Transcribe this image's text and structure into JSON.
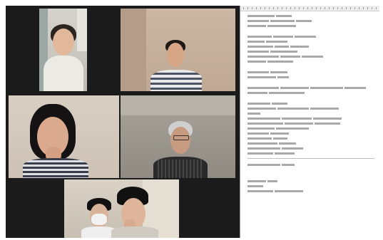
{
  "meeting": {
    "participants": [
      {
        "tile": "top-left"
      },
      {
        "tile": "top-right"
      },
      {
        "tile": "middle-left"
      },
      {
        "tile": "middle-right"
      },
      {
        "tile": "bottom-center"
      }
    ]
  },
  "document": {
    "text_visible": false
  },
  "colors": {
    "grid_background": "#1b1b1b",
    "document_background": "#ffffff",
    "document_text": "#8c8c8c"
  }
}
